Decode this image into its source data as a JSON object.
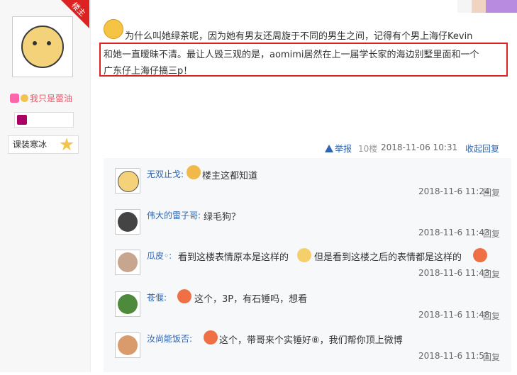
{
  "author": {
    "badge": "楼主",
    "name": "我只是蕾油",
    "tag": "课装寒冰"
  },
  "post": {
    "line1": "为什么叫她绿茶呢，因为她有男友还周旋于不同的男生之间，记得有个男上海仔Kevin",
    "line2": "和她一直暧昧不清。最让人毁三观的是，aomimi居然在上一届学长家的海边别墅里面和一个",
    "line3": "广东仔上海仔搞三p！"
  },
  "meta": {
    "report": "举报",
    "floor": "10楼",
    "time": "2018-11-06 10:31",
    "collapse": "收起回复"
  },
  "replies": [
    {
      "name": "无双止戈:",
      "text": "楼主这都知道",
      "time": "2018-11-6 11:24",
      "reply": "回复"
    },
    {
      "name": "伟大的雷子哥:",
      "text": "绿毛狗？",
      "time": "2018-11-6 11:43",
      "reply": "回复"
    },
    {
      "name": "瓜皮◦:",
      "text": "看到这楼表情原本是这样的",
      "text2": "但是看到这楼之后的表情都是这样的",
      "time": "2018-11-6 11:43",
      "reply": "回复"
    },
    {
      "name": "苍偃:",
      "text": "这个，3P，有石锤吗，想看",
      "time": "2018-11-6 11:48",
      "reply": "回复"
    },
    {
      "name": "汝尚能饭否:",
      "text": "这个，带哥来个实锤好⑧，我们帮你顶上微博",
      "time": "2018-11-6 11:51",
      "reply": "回复"
    }
  ],
  "colors": {
    "accent": "#2d64b3",
    "highlight": "#dd2222",
    "name_pink": "#ee5566"
  }
}
